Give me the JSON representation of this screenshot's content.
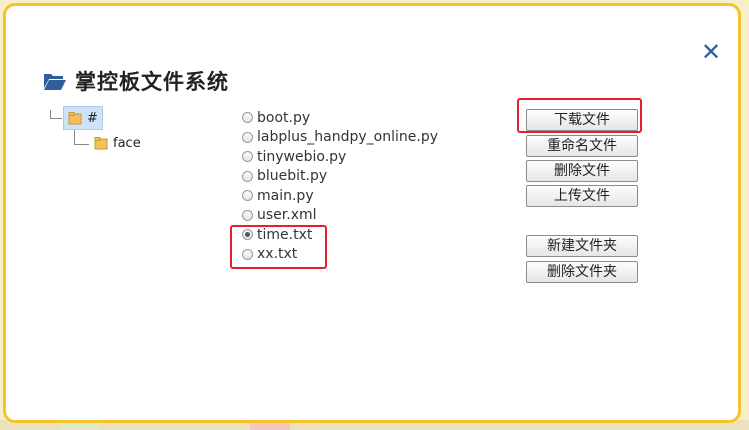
{
  "dialog": {
    "title": "掌控板文件系统",
    "close_icon": "close-icon",
    "accent_color": "#f5c230"
  },
  "tree": {
    "root": "#",
    "children": [
      "face"
    ]
  },
  "files": [
    {
      "name": "boot.py",
      "selected": false
    },
    {
      "name": "labplus_handpy_online.py",
      "selected": false
    },
    {
      "name": "tinywebio.py",
      "selected": false
    },
    {
      "name": "bluebit.py",
      "selected": false
    },
    {
      "name": "main.py",
      "selected": false
    },
    {
      "name": "user.xml",
      "selected": false
    },
    {
      "name": "time.txt",
      "selected": true
    },
    {
      "name": "xx.txt",
      "selected": false
    }
  ],
  "buttons": {
    "download": "下载文件",
    "rename": "重命名文件",
    "delete": "删除文件",
    "upload": "上传文件",
    "new_folder": "新建文件夹",
    "delete_folder": "删除文件夹"
  },
  "highlight_color": "#e4202a"
}
